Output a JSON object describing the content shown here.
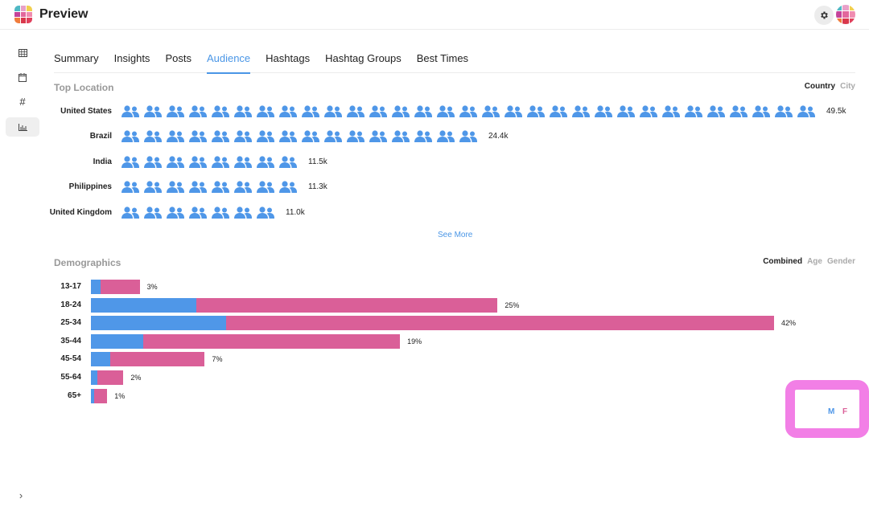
{
  "app": {
    "title": "Preview",
    "logo_colors": [
      "#4fb8c4",
      "#e8a0c8",
      "#f2d04e",
      "#c4439a",
      "#e2679c",
      "#f08cb0",
      "#f07c3c",
      "#d9384c",
      "#e0405c"
    ]
  },
  "header": {
    "settings_icon": "gear-icon",
    "avatar_colors": [
      "#4fb8c4",
      "#e8a0c8",
      "#f2d04e",
      "#c4439a",
      "#e2679c",
      "#f08cb0",
      "#f07c3c",
      "#d9384c",
      "#e0405c"
    ]
  },
  "sidebar": {
    "items": [
      {
        "icon": "grid-icon",
        "glyph": "▦",
        "active": false
      },
      {
        "icon": "calendar-icon",
        "glyph": "▭",
        "active": false
      },
      {
        "icon": "hashtag-icon",
        "glyph": "#",
        "active": false
      },
      {
        "icon": "bar-chart-icon",
        "glyph": "ılı",
        "active": true
      }
    ],
    "expand_glyph": "›"
  },
  "tabs": [
    {
      "label": "Summary",
      "active": false
    },
    {
      "label": "Insights",
      "active": false
    },
    {
      "label": "Posts",
      "active": false
    },
    {
      "label": "Audience",
      "active": true
    },
    {
      "label": "Hashtags",
      "active": false
    },
    {
      "label": "Hashtag Groups",
      "active": false
    },
    {
      "label": "Best Times",
      "active": false
    }
  ],
  "top_location": {
    "title": "Top Location",
    "toggle": [
      {
        "label": "Country",
        "active": true
      },
      {
        "label": "City",
        "active": false
      }
    ],
    "rows": [
      {
        "label": "United States",
        "icons": 31,
        "value": "49.5k"
      },
      {
        "label": "Brazil",
        "icons": 16,
        "value": "24.4k"
      },
      {
        "label": "India",
        "icons": 8,
        "value": "11.5k"
      },
      {
        "label": "Philippines",
        "icons": 8,
        "value": "11.3k"
      },
      {
        "label": "United Kingdom",
        "icons": 7,
        "value": "11.0k"
      }
    ],
    "see_more": "See More"
  },
  "demographics": {
    "title": "Demographics",
    "toggle": [
      {
        "label": "Combined",
        "active": true
      },
      {
        "label": "Age",
        "active": false
      },
      {
        "label": "Gender",
        "active": false
      }
    ],
    "legend": {
      "male": "M",
      "female": "F"
    },
    "colors": {
      "male": "#4f97e8",
      "female": "#da5f98"
    }
  },
  "chart_data": {
    "type": "bar",
    "orientation": "horizontal-stacked",
    "title": "Demographics",
    "categories": [
      "13-17",
      "18-24",
      "25-34",
      "35-44",
      "45-54",
      "55-64",
      "65+"
    ],
    "totals_percent": [
      3,
      25,
      42,
      19,
      7,
      2,
      1
    ],
    "total_labels": [
      "3%",
      "25%",
      "42%",
      "19%",
      "7%",
      "2%",
      "1%"
    ],
    "series": [
      {
        "name": "M",
        "values": [
          0.6,
          6.5,
          8.3,
          3.2,
          1.2,
          0.4,
          0.2
        ]
      },
      {
        "name": "F",
        "values": [
          2.4,
          18.5,
          33.7,
          15.8,
          5.8,
          1.6,
          0.8
        ]
      }
    ],
    "xlim": [
      0,
      42
    ],
    "legend": "bottom-right",
    "grid": false
  }
}
